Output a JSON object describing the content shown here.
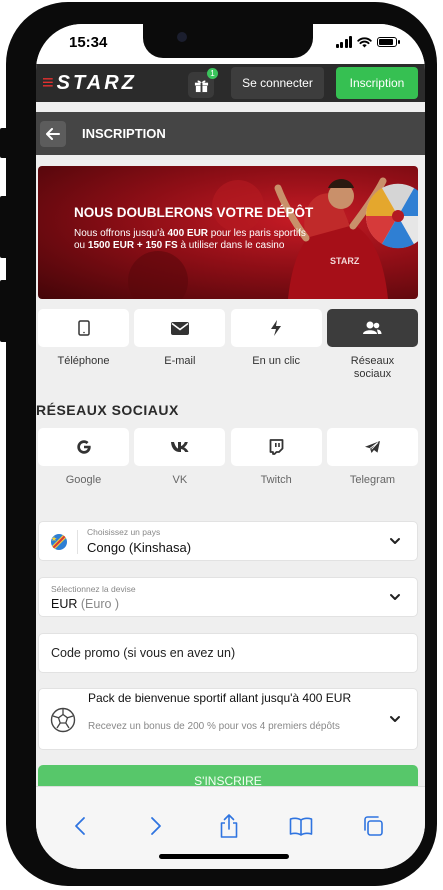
{
  "status_bar": {
    "time": "15:34"
  },
  "header": {
    "logo_prefix": "≡",
    "logo_text": "STARZ",
    "gift_badge": "1",
    "login_label": "Se connecter",
    "register_label": "Inscription"
  },
  "subheader": {
    "title": "INSCRIPTION"
  },
  "banner": {
    "title": "NOUS DOUBLERONS VOTRE DÉPÔT",
    "line1_prefix": "Nous offrons jusqu'à ",
    "line1_bold": "400 EUR",
    "line1_suffix": " pour les paris sportifs",
    "line2_prefix": "ou ",
    "line2_bold": "1500 EUR + 150 FS",
    "line2_suffix": " à utiliser dans le casino"
  },
  "methods": [
    {
      "label": "Téléphone",
      "icon": "phone-icon",
      "active": false
    },
    {
      "label": "E-mail",
      "icon": "envelope-icon",
      "active": false
    },
    {
      "label": "En un clic",
      "icon": "lightning-icon",
      "active": false
    },
    {
      "label": "Réseaux sociaux",
      "icon": "users-icon",
      "active": true
    }
  ],
  "social_section": {
    "title": "RÉSEAUX SOCIAUX",
    "items": [
      {
        "label": "Google",
        "icon": "google-icon"
      },
      {
        "label": "VK",
        "icon": "vk-icon"
      },
      {
        "label": "Twitch",
        "icon": "twitch-icon"
      },
      {
        "label": "Telegram",
        "icon": "telegram-icon"
      }
    ]
  },
  "form": {
    "country": {
      "label": "Choisissez un pays",
      "value": "Congo (Kinshasa)",
      "flag_icon": "drc-flag-icon"
    },
    "currency": {
      "label": "Sélectionnez la devise",
      "code": "EUR",
      "name": "(Euro )"
    },
    "promo": {
      "placeholder": "Code promo (si vous en avez un)"
    },
    "bonus": {
      "title": "Pack de bienvenue sportif allant jusqu'à 400 EUR",
      "description": "Recevez un bonus de 200 % pour vos 4 premiers dépôts",
      "icon": "football-icon"
    },
    "submit_label": "S'INSCRIRE"
  },
  "browser": {
    "icons": [
      "back-arrow-icon",
      "forward-arrow-icon",
      "share-icon",
      "bookmarks-icon",
      "tabs-icon"
    ]
  },
  "colors": {
    "accent_green": "#36c052",
    "brand_red": "#e5302f",
    "header_bg": "#2b2b2b"
  }
}
